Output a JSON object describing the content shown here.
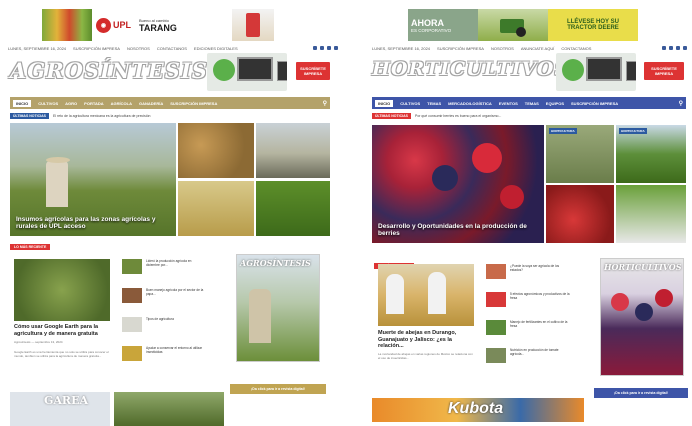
{
  "left": {
    "topad": {
      "brand": "UPL",
      "slogan_1": "Bueno al cambio",
      "brand_2": "TARANG",
      "url": "www.uplmx.com.mx"
    },
    "utilbar": {
      "date": "LUNES, SEPTIEMBRE 16, 2024",
      "links": [
        "SUSCRIPCIÓN IMPRESA",
        "NOSOTROS",
        "CONTACTANOS",
        "EDICIONES DIGITALES"
      ]
    },
    "logo": "AGROSÍNTESIS",
    "subscribe": "SUSCRÍBETE\nIMPRESA",
    "nav": [
      "INICIO",
      "CULTIVOS",
      "AGRO",
      "PORTADA",
      "AGRÍCOLA",
      "GANADERÍA",
      "SUSCRIPCIÓN IMPRESA"
    ],
    "ticker": {
      "tag": "ÚLTIMAS NOTICIAS",
      "text": "El reto de la agricultura mexicana es la agricultura de precisión"
    },
    "hero_caption": "Insumos agrícolas para las zonas agrícolas y rurales de UPL acceso",
    "section": "LO MÁS RECIENTE",
    "main_headline": "Cómo usar Google Earth para la agricultura y de manera gratuita",
    "main_meta": "Agrosíntesis  —  septiembre 13, 2024",
    "main_desc": "Google Earth es una herramienta que no solo se utiliza para conocer el mundo, también se utiliza para la agricultura de manera gratuita...",
    "list": [
      {
        "text": "Lideró la producción agrícola en diciembre por..."
      },
      {
        "text": "Buen manejo agrícola por el sector de la papa..."
      },
      {
        "text": "Tipos de agricultura"
      },
      {
        "text": "Ayudar a conservar el entorno al utilizar insecticidas"
      }
    ],
    "cover_title": "AGROSÍNTESIS",
    "ad_label": "¡Da click para ir a revista digital!",
    "bottom_logo": "GAREA"
  },
  "right": {
    "topad": {
      "line_1": "AHORA",
      "line_2": "ES CORPORATIVO",
      "cta": "LLÉVESE HOY SU TRACTOR DEERE"
    },
    "utilbar": {
      "date": "LUNES, SEPTIEMBRE 16, 2024",
      "links": [
        "SUSCRIPCIÓN IMPRESA",
        "NOSOTROS",
        "ANUNCIATE AQUÍ",
        "CONTACTANOS"
      ]
    },
    "logo": "HORTICULTIVOS",
    "subscribe": "SUSCRÍBETE\nIMPRESA",
    "nav": [
      "INICIO",
      "CULTIVOS",
      "TEMAS",
      "MERCADO/LOGÍSTICA",
      "EVENTOS",
      "TEMAS",
      "EQUIPOS",
      "SUSCRIPCIÓN IMPRESA"
    ],
    "ticker": {
      "tag": "ÚLTIMAS NOTICIAS",
      "text": "Por qué consumir berries es bueno para el organismo..."
    },
    "hero_caption": "Desarrollo y Oportunidades en la producción de berries",
    "section": "LO MÁS RECIENTE",
    "main_headline": "Muerte de abejas en Durango, Guanajuato y Jalisco: ¿es la relación...",
    "main_desc": "La mortandad de abejas en varias regiones de México se relaciona con el uso de insecticidas...",
    "list": [
      {
        "text": "¿Puede la soya ser agrícola de los estados?"
      },
      {
        "text": "5 efectos agronómicos y productivos de la fresa"
      },
      {
        "text": "Manejo de fertilizantes en el cultivo de la fresa"
      },
      {
        "text": "Nutrición en producción de tomate agrícola..."
      }
    ],
    "cover_title": "HORTICULTIVOS",
    "ad_label": "¡Da click para ir a revista digital!",
    "bottom_brand": "Kubota"
  }
}
